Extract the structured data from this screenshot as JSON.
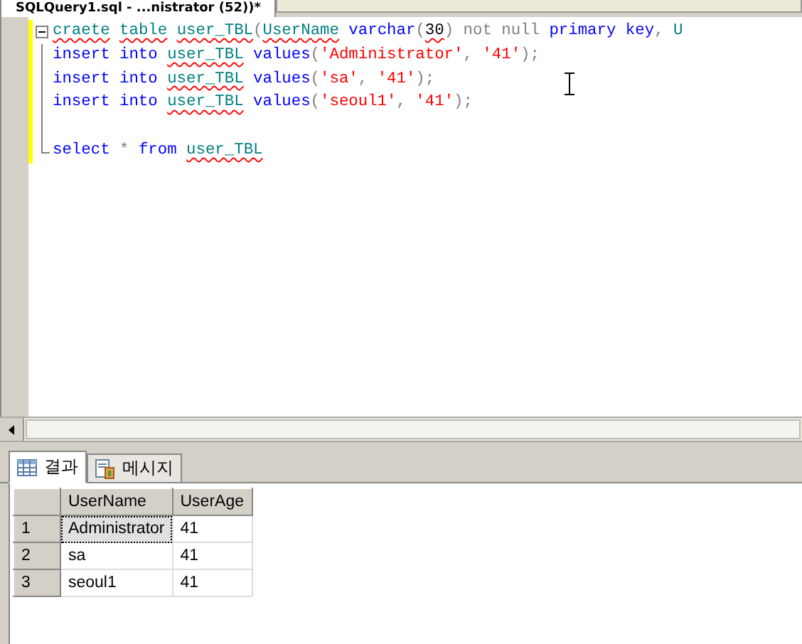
{
  "editor_tab": {
    "title": "SQLQuery1.sql - ...nistrator (52))*"
  },
  "code_lines": [
    {
      "kind": "fold-start",
      "tokens": [
        {
          "kind": "id",
          "text": "craete table user_TBL",
          "error": true
        },
        {
          "kind": "op",
          "text": "("
        },
        {
          "kind": "id",
          "text": "UserName",
          "error": true
        },
        {
          "kind": "kw",
          "text": " varchar"
        },
        {
          "kind": "op",
          "text": "("
        },
        {
          "kind": "txt",
          "text": "30",
          "error": true
        },
        {
          "kind": "op",
          "text": ") not null "
        },
        {
          "kind": "kw",
          "text": "primary key"
        },
        {
          "kind": "op",
          "text": ", "
        },
        {
          "kind": "id",
          "text": "U"
        }
      ]
    },
    {
      "kind": "fold-line",
      "tokens": [
        {
          "kind": "kw",
          "text": "insert into "
        },
        {
          "kind": "id",
          "text": "user_TBL",
          "error": true
        },
        {
          "kind": "kw",
          "text": " values"
        },
        {
          "kind": "op",
          "text": "("
        },
        {
          "kind": "str",
          "text": "'Administrator'"
        },
        {
          "kind": "op",
          "text": ", "
        },
        {
          "kind": "str",
          "text": "'41'"
        },
        {
          "kind": "op",
          "text": ");"
        }
      ]
    },
    {
      "kind": "fold-line",
      "tokens": [
        {
          "kind": "kw",
          "text": "insert into "
        },
        {
          "kind": "id",
          "text": "user_TBL",
          "error": true
        },
        {
          "kind": "kw",
          "text": " values"
        },
        {
          "kind": "op",
          "text": "("
        },
        {
          "kind": "str",
          "text": "'sa'"
        },
        {
          "kind": "op",
          "text": ", "
        },
        {
          "kind": "str",
          "text": "'41'"
        },
        {
          "kind": "op",
          "text": ");"
        }
      ]
    },
    {
      "kind": "fold-line",
      "tokens": [
        {
          "kind": "kw",
          "text": "insert into "
        },
        {
          "kind": "id",
          "text": "user_TBL",
          "error": true
        },
        {
          "kind": "kw",
          "text": " values"
        },
        {
          "kind": "op",
          "text": "("
        },
        {
          "kind": "str",
          "text": "'seoul1'"
        },
        {
          "kind": "op",
          "text": ", "
        },
        {
          "kind": "str",
          "text": "'41'"
        },
        {
          "kind": "op",
          "text": ");"
        }
      ]
    },
    {
      "kind": "fold-line"
    },
    {
      "kind": "fold-end",
      "tokens": [
        {
          "kind": "kw",
          "text": "select"
        },
        {
          "kind": "op",
          "text": " * "
        },
        {
          "kind": "kw",
          "text": "from "
        },
        {
          "kind": "id",
          "text": "user_TBL",
          "error": true
        }
      ]
    }
  ],
  "result_tabs": [
    {
      "label": "결과",
      "kind": "grid",
      "selected": true
    },
    {
      "label": "메시지",
      "kind": "messages",
      "selected": false
    }
  ],
  "grid": {
    "columns": [
      "UserName",
      "UserAge"
    ],
    "rows": [
      {
        "number": "1",
        "cells": [
          "Administrator",
          "41"
        ],
        "focused": true
      },
      {
        "number": "2",
        "cells": [
          "sa",
          "41"
        ],
        "focused": false
      },
      {
        "number": "3",
        "cells": [
          "seoul1",
          "41"
        ],
        "focused": false
      }
    ]
  }
}
